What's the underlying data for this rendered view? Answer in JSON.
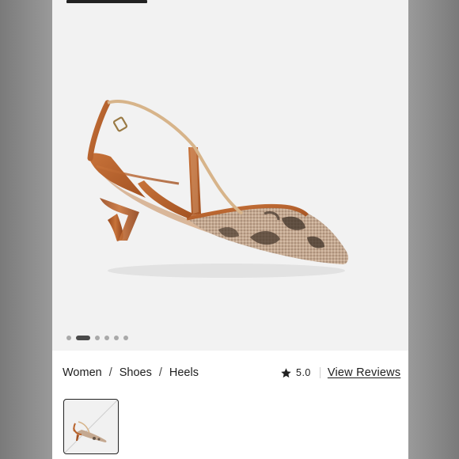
{
  "breadcrumb": {
    "women": "Women",
    "shoes": "Shoes",
    "heels": "Heels",
    "separator": "/"
  },
  "rating": {
    "value": "5.0",
    "star_icon": "star-icon",
    "reviews_link": "View Reviews"
  },
  "carousel": {
    "total_slides": 6,
    "active_slide": 2
  },
  "colors": {
    "leather": "#b8632c",
    "mesh": "#b99a84",
    "accent_dark": "#222222"
  }
}
